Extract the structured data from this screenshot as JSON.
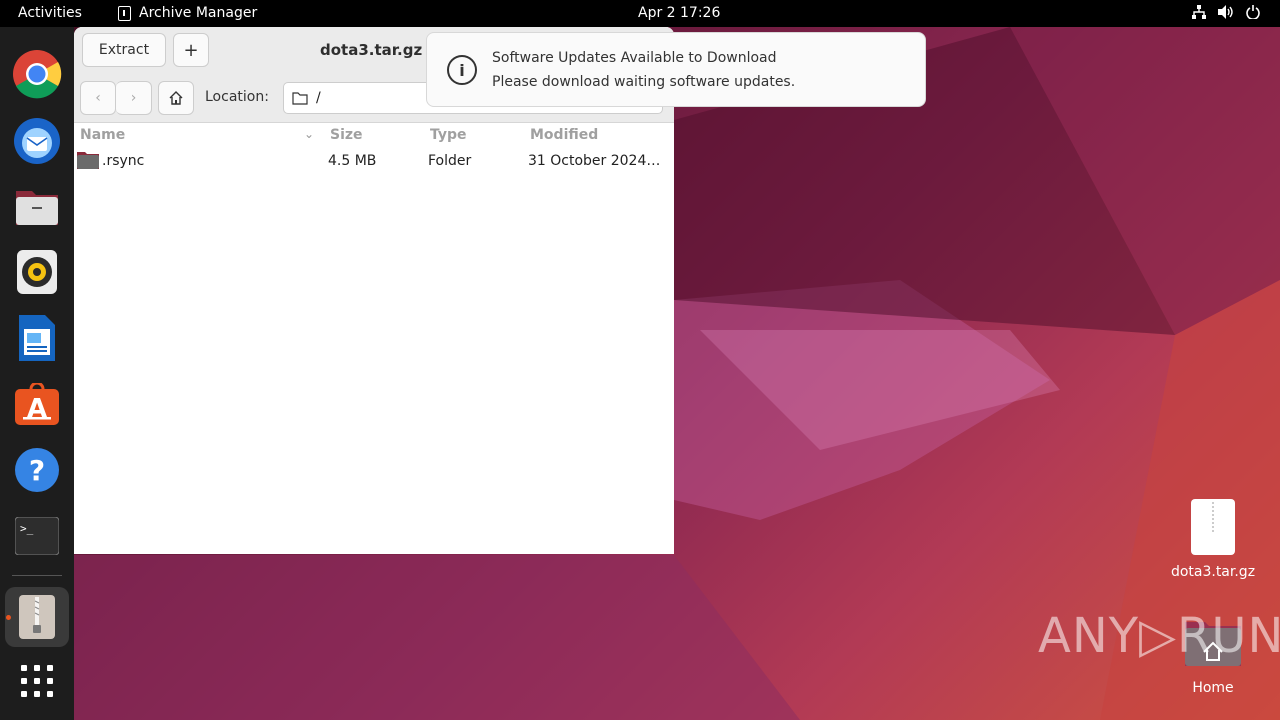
{
  "topbar": {
    "activities": "Activities",
    "app_name": "Archive Manager",
    "clock": "Apr 2  17:26"
  },
  "dock": {
    "items": [
      "chrome",
      "thunderbird",
      "files",
      "rhythmbox",
      "libreoffice-writer",
      "app-center",
      "help",
      "terminal",
      "archive-manager",
      "show-apps"
    ]
  },
  "window": {
    "title": "dota3.tar.gz",
    "extract_label": "Extract",
    "add_label": "+",
    "location_label": "Location:",
    "location_value": "/",
    "columns": [
      "Name",
      "Size",
      "Type",
      "Modified"
    ],
    "rows": [
      {
        "name": ".rsync",
        "size": "4.5 MB",
        "type": "Folder",
        "modified": "31 October 2024…"
      }
    ]
  },
  "notification": {
    "title": "Software Updates Available to Download",
    "body": "Please download waiting software updates."
  },
  "desktop": {
    "icons": [
      {
        "label": "dota3.tar.gz"
      },
      {
        "label": "Home"
      }
    ]
  },
  "watermark": "ANY▷RUN"
}
